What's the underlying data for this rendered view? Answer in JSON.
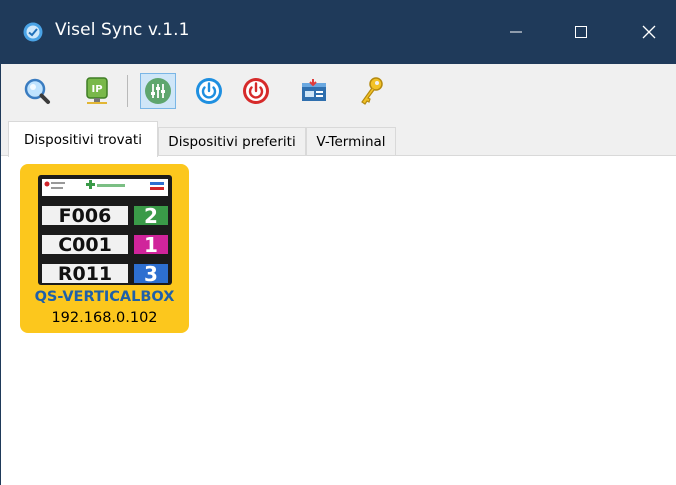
{
  "window": {
    "title": "Visel Sync v.1.1",
    "controls": {
      "minimize": "minimize",
      "maximize": "maximize",
      "close": "close"
    }
  },
  "toolbar": {
    "buttons": [
      {
        "icon": "magnifier-icon"
      },
      {
        "icon": "ip-icon"
      },
      {
        "icon": "sliders-icon",
        "active": true
      },
      {
        "icon": "power-on-icon"
      },
      {
        "icon": "power-off-icon"
      },
      {
        "icon": "network-card-icon"
      },
      {
        "icon": "key-icon"
      }
    ]
  },
  "tabs": [
    {
      "label": "Dispositivi trovati",
      "selected": true
    },
    {
      "label": "Dispositivi preferiti",
      "selected": false
    },
    {
      "label": "V-Terminal",
      "selected": false
    }
  ],
  "devices": [
    {
      "name": "QS-VERTICALBOX",
      "ip": "192.168.0.102",
      "preview": {
        "rows": [
          {
            "code": "F006",
            "number": "2",
            "header_color": "#3a9a48",
            "number_color": "#3a9a48"
          },
          {
            "code": "C001",
            "number": "1",
            "header_color": "#d0249b",
            "number_color": "#d0249b"
          },
          {
            "code": "R011",
            "number": "3",
            "header_color": "#2d6fd0",
            "number_color": "#2d6fd0"
          }
        ]
      }
    }
  ],
  "colors": {
    "titlebar": "#1f3a5a",
    "tile": "#fcc71d",
    "device_name": "#1f60a8"
  }
}
